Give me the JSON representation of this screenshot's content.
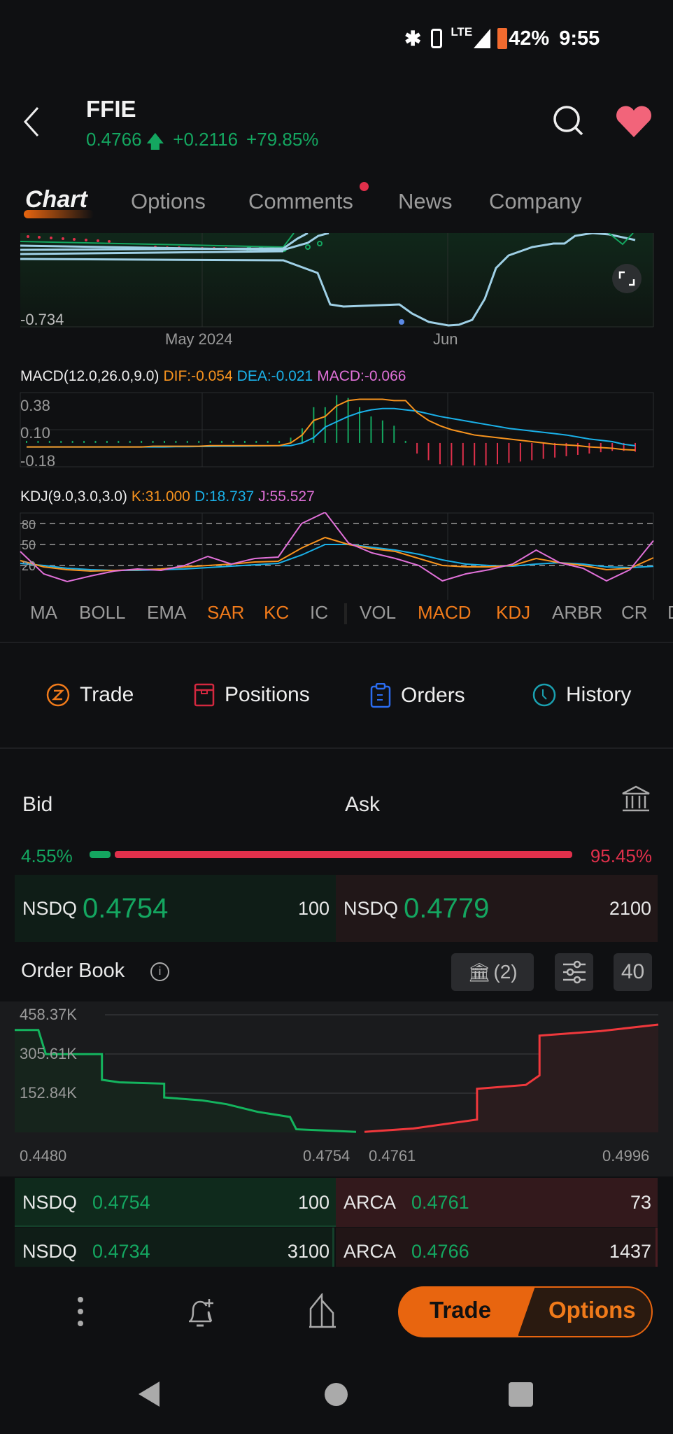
{
  "status_bar": {
    "battery": "42%",
    "time": "9:55",
    "network": "LTE",
    "icons": [
      "bluetooth-icon",
      "vibrate-icon",
      "lte-icon",
      "signal-icon",
      "battery-icon"
    ]
  },
  "header": {
    "symbol": "FFIE",
    "price": "0.4766",
    "change": "+0.2116",
    "change_pct": "+79.85%",
    "price_color": "#14a660"
  },
  "tabs": [
    {
      "label": "Chart",
      "active": true
    },
    {
      "label": "Options"
    },
    {
      "label": "Comments",
      "badge": true
    },
    {
      "label": "News"
    },
    {
      "label": "Company"
    }
  ],
  "price_chart": {
    "y_label": "-0.734",
    "x_labels": [
      "May 2024",
      "Jun"
    ]
  },
  "macd": {
    "title": "MACD(12.0,26.0,9.0)",
    "dif": "DIF:-0.054",
    "dea": "DEA:-0.021",
    "macd": "MACD:-0.066",
    "colors": {
      "dif": "#f7931e",
      "dea": "#1ab0e8",
      "macd": "#e070d8",
      "up": "#14a660",
      "down": "#e0304b"
    }
  },
  "kdj": {
    "title": "KDJ(9.0,3.0,3.0)",
    "k": "K:31.000",
    "d": "D:18.737",
    "j": "J:55.527"
  },
  "indicators": [
    {
      "label": "MA"
    },
    {
      "label": "BOLL"
    },
    {
      "label": "EMA"
    },
    {
      "label": "SAR",
      "active": true
    },
    {
      "label": "KC",
      "active": true
    },
    {
      "label": "IC"
    },
    {
      "label": "VOL"
    },
    {
      "label": "MACD",
      "active": true
    },
    {
      "label": "KDJ",
      "active": true
    },
    {
      "label": "ARBR"
    },
    {
      "label": "CR"
    },
    {
      "label": "D"
    }
  ],
  "actions": [
    {
      "label": "Trade",
      "icon": "trade-z-icon"
    },
    {
      "label": "Positions",
      "icon": "positions-icon"
    },
    {
      "label": "Orders",
      "icon": "clipboard-icon"
    },
    {
      "label": "History",
      "icon": "clock-icon"
    }
  ],
  "quote": {
    "bid_label": "Bid",
    "ask_label": "Ask",
    "bid_pct": "4.55%",
    "ask_pct": "95.45%",
    "bid_ratio": 4.55,
    "bid": {
      "exchange": "NSDQ",
      "price": "0.4754",
      "size": "100"
    },
    "ask": {
      "exchange": "NSDQ",
      "price": "0.4779",
      "size": "2100"
    }
  },
  "order_book": {
    "title": "Order Book",
    "exchanges_label": "(2)",
    "depth": "40",
    "rows": [
      {
        "bid_ex": "NSDQ",
        "bid_price": "0.4754",
        "bid_size": "100",
        "ask_ex": "ARCA",
        "ask_price": "0.4761",
        "ask_size": "73"
      },
      {
        "bid_ex": "NSDQ",
        "bid_price": "0.4734",
        "bid_size": "3100",
        "ask_ex": "ARCA",
        "ask_price": "0.4766",
        "ask_size": "1437"
      }
    ]
  },
  "bottom_bar": {
    "trade": "Trade",
    "options": "Options"
  },
  "chart_data": [
    {
      "type": "line",
      "name": "MACD",
      "ylim": [
        -0.18,
        0.38
      ],
      "y_ticks": [
        "0.38",
        "0.10",
        "-0.18"
      ],
      "dif": [
        -0.03,
        -0.03,
        -0.03,
        -0.03,
        -0.03,
        -0.03,
        -0.03,
        -0.03,
        -0.03,
        -0.03,
        -0.03,
        -0.025,
        -0.025,
        -0.025,
        -0.025,
        -0.025,
        -0.02,
        -0.02,
        -0.02,
        -0.02,
        -0.02,
        -0.02,
        -0.02,
        0.0,
        0.06,
        0.17,
        0.2,
        0.28,
        0.32,
        0.33,
        0.33,
        0.33,
        0.32,
        0.32,
        0.23,
        0.17,
        0.13,
        0.1,
        0.08,
        0.06,
        0.05,
        0.04,
        0.03,
        0.02,
        0.01,
        0.0,
        -0.01,
        -0.015,
        -0.02,
        -0.03,
        -0.035,
        -0.04,
        -0.05,
        -0.054
      ],
      "dea": [
        -0.03,
        -0.03,
        -0.03,
        -0.03,
        -0.03,
        -0.03,
        -0.03,
        -0.03,
        -0.03,
        -0.03,
        -0.03,
        -0.03,
        -0.03,
        -0.028,
        -0.028,
        -0.027,
        -0.026,
        -0.025,
        -0.025,
        -0.024,
        -0.023,
        -0.022,
        -0.021,
        -0.02,
        0.0,
        0.04,
        0.12,
        0.16,
        0.2,
        0.23,
        0.25,
        0.26,
        0.26,
        0.25,
        0.24,
        0.22,
        0.2,
        0.185,
        0.17,
        0.155,
        0.14,
        0.125,
        0.11,
        0.1,
        0.09,
        0.08,
        0.07,
        0.06,
        0.045,
        0.03,
        0.02,
        0.01,
        -0.01,
        -0.021
      ],
      "hist": [
        0.01,
        0.01,
        0.01,
        0.01,
        0.01,
        0.01,
        0.01,
        0.01,
        0.01,
        0.01,
        0.01,
        0.01,
        0.01,
        0.01,
        0.01,
        0.01,
        0.01,
        0.01,
        0.01,
        0.01,
        0.01,
        0.01,
        0.01,
        0.04,
        0.11,
        0.27,
        0.27,
        0.36,
        0.34,
        0.27,
        0.2,
        0.17,
        0.13,
        0.0,
        -0.08,
        -0.13,
        -0.16,
        -0.17,
        -0.17,
        -0.17,
        -0.17,
        -0.16,
        -0.15,
        -0.14,
        -0.13,
        -0.12,
        -0.11,
        -0.1,
        -0.09,
        -0.08,
        -0.07,
        -0.06,
        -0.06,
        -0.066
      ]
    },
    {
      "type": "line",
      "name": "KDJ",
      "ylim": [
        0,
        100
      ],
      "y_ticks": [
        "80",
        "50",
        "20"
      ],
      "k": [
        27,
        18,
        14,
        12,
        13,
        14,
        15,
        18,
        20,
        22,
        25,
        26,
        45,
        60,
        50,
        44,
        40,
        30,
        20,
        18,
        18,
        20,
        30,
        24,
        20,
        14,
        16,
        31
      ],
      "d": [
        23,
        20,
        16,
        14,
        13,
        13,
        14,
        15,
        17,
        19,
        21,
        23,
        35,
        50,
        50,
        46,
        42,
        36,
        28,
        22,
        20,
        19,
        22,
        24,
        22,
        18,
        17,
        18.737
      ],
      "j": [
        40,
        8,
        -3,
        5,
        12,
        15,
        13,
        20,
        33,
        22,
        30,
        32,
        80,
        96,
        52,
        38,
        30,
        20,
        -2,
        8,
        14,
        22,
        42,
        24,
        16,
        -2,
        14,
        55.527
      ]
    },
    {
      "type": "area",
      "name": "Depth",
      "y_ticks": [
        "458.37K",
        "305.61K",
        "152.84K"
      ],
      "x_ticks": [
        "0.4480",
        "0.4754",
        "0.4761",
        "0.4996"
      ],
      "ylim": [
        0,
        458.37
      ],
      "bid": [
        [
          0.448,
          399
        ],
        [
          0.4499,
          399
        ],
        [
          0.4505,
          305
        ],
        [
          0.455,
          305
        ],
        [
          0.455,
          205
        ],
        [
          0.4564,
          195
        ],
        [
          0.46,
          190
        ],
        [
          0.46,
          136
        ],
        [
          0.463,
          125
        ],
        [
          0.465,
          110
        ],
        [
          0.4675,
          80
        ],
        [
          0.4701,
          60
        ],
        [
          0.4706,
          12
        ],
        [
          0.4754,
          2
        ]
      ],
      "ask": [
        [
          0.4761,
          2
        ],
        [
          0.48,
          15
        ],
        [
          0.4851,
          50
        ],
        [
          0.4851,
          170
        ],
        [
          0.489,
          185
        ],
        [
          0.4901,
          222
        ],
        [
          0.4901,
          377
        ],
        [
          0.495,
          395
        ],
        [
          0.4996,
          420
        ]
      ]
    }
  ]
}
